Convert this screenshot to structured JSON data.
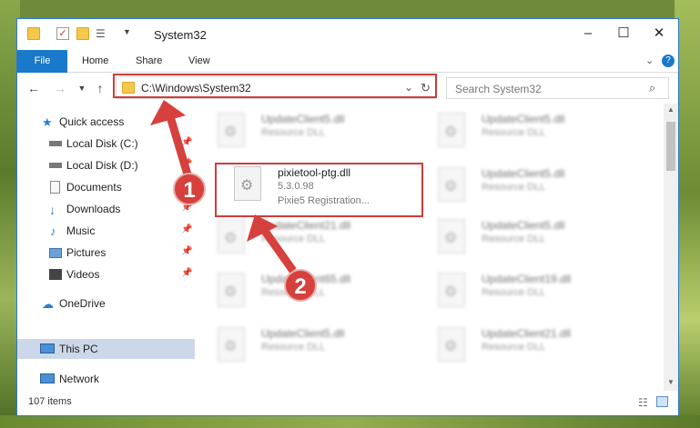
{
  "window": {
    "title": "System32"
  },
  "ribbon": {
    "tabs": [
      "File",
      "Home",
      "Share",
      "View"
    ]
  },
  "address": {
    "path": "C:\\Windows\\System32",
    "search_placeholder": "Search System32"
  },
  "nav": {
    "items": [
      {
        "label": "Quick access",
        "icon": "star-icon"
      },
      {
        "label": "Local Disk (C:)",
        "icon": "drive-icon"
      },
      {
        "label": "Local Disk (D:)",
        "icon": "drive-icon"
      },
      {
        "label": "Documents",
        "icon": "documents-icon"
      },
      {
        "label": "Downloads",
        "icon": "download-icon"
      },
      {
        "label": "Music",
        "icon": "music-icon"
      },
      {
        "label": "Pictures",
        "icon": "pictures-icon"
      },
      {
        "label": "Videos",
        "icon": "videos-icon"
      },
      {
        "label": "OneDrive",
        "icon": "cloud-icon"
      },
      {
        "label": "This PC",
        "icon": "computer-icon"
      },
      {
        "label": "Network",
        "icon": "network-icon"
      }
    ]
  },
  "files": {
    "highlighted": {
      "name": "pixietool-ptg.dll",
      "version": "5.3.0.98",
      "type": "Pixie5 Registration..."
    },
    "blurred": [
      {
        "name": "UpdateClient5.dll",
        "type": "Resource DLL"
      },
      {
        "name": "UpdateClient5.dll",
        "type": "Resource DLL"
      },
      {
        "name": "UpdateClient5.dll",
        "type": "Resource DLL"
      },
      {
        "name": "UpdateClient21.dll",
        "type": "Resource DLL"
      },
      {
        "name": "UpdateClient5.dll",
        "type": "Resource DLL"
      },
      {
        "name": "UpdateClient65.dll",
        "type": "Resource DLL"
      },
      {
        "name": "UpdateClient19.dll",
        "type": "Resource DLL"
      },
      {
        "name": "UpdateClient5.dll",
        "type": "Resource DLL"
      },
      {
        "name": "UpdateClient21.dll",
        "type": "Resource DLL"
      }
    ]
  },
  "status": {
    "items": "107 items"
  },
  "callouts": [
    "1",
    "2"
  ],
  "colors": {
    "accent": "#1979ca",
    "highlight": "#d03b3b"
  }
}
